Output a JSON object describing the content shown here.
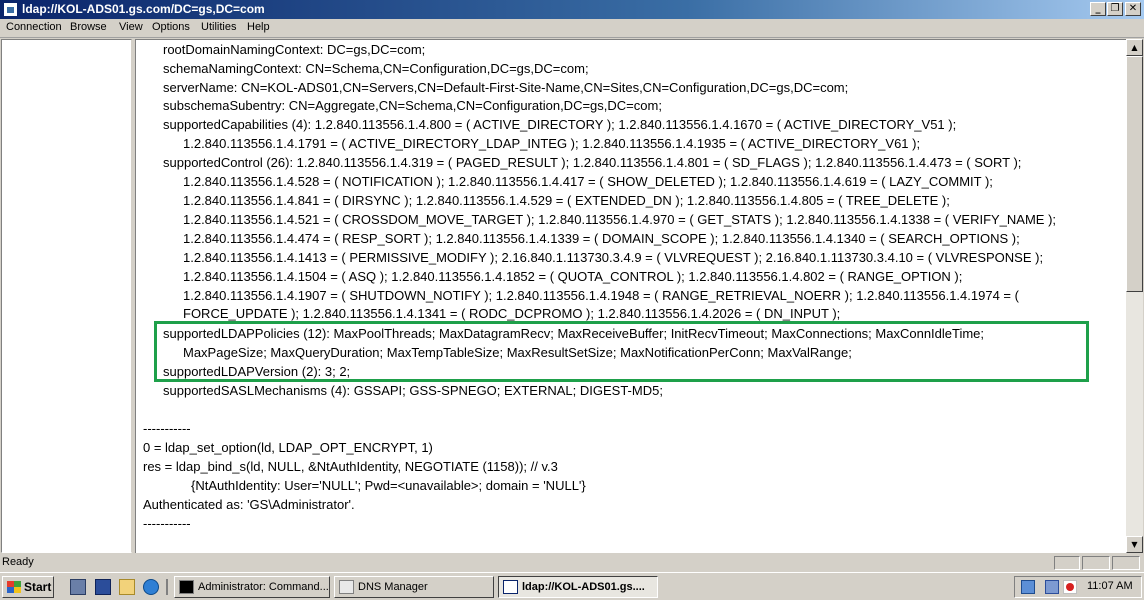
{
  "window": {
    "title": "ldap://KOL-ADS01.gs.com/DC=gs,DC=com",
    "min_glyph": "_",
    "max_glyph": "❐",
    "close_glyph": "✕"
  },
  "menu": [
    "Connection",
    "Browse",
    "View",
    "Options",
    "Utilities",
    "Help"
  ],
  "content_lines": [
    "rootDomainNamingContext: DC=gs,DC=com;",
    "schemaNamingContext: CN=Schema,CN=Configuration,DC=gs,DC=com;",
    "serverName: CN=KOL-ADS01,CN=Servers,CN=Default-First-Site-Name,CN=Sites,CN=Configuration,DC=gs,DC=com;",
    "subschemaSubentry: CN=Aggregate,CN=Schema,CN=Configuration,DC=gs,DC=com;",
    "supportedCapabilities (4): 1.2.840.113556.1.4.800 = ( ACTIVE_DIRECTORY ); 1.2.840.113556.1.4.1670 = ( ACTIVE_DIRECTORY_V51 );",
    "1.2.840.113556.1.4.1791 = ( ACTIVE_DIRECTORY_LDAP_INTEG ); 1.2.840.113556.1.4.1935 = ( ACTIVE_DIRECTORY_V61 );",
    "supportedControl (26): 1.2.840.113556.1.4.319 = ( PAGED_RESULT ); 1.2.840.113556.1.4.801 = ( SD_FLAGS ); 1.2.840.113556.1.4.473 = ( SORT );",
    "1.2.840.113556.1.4.528 = ( NOTIFICATION ); 1.2.840.113556.1.4.417 = ( SHOW_DELETED ); 1.2.840.113556.1.4.619 = ( LAZY_COMMIT );",
    "1.2.840.113556.1.4.841 = ( DIRSYNC ); 1.2.840.113556.1.4.529 = ( EXTENDED_DN ); 1.2.840.113556.1.4.805 = ( TREE_DELETE );",
    "1.2.840.113556.1.4.521 = ( CROSSDOM_MOVE_TARGET ); 1.2.840.113556.1.4.970 = ( GET_STATS ); 1.2.840.113556.1.4.1338 = ( VERIFY_NAME );",
    "1.2.840.113556.1.4.474 = ( RESP_SORT ); 1.2.840.113556.1.4.1339 = ( DOMAIN_SCOPE ); 1.2.840.113556.1.4.1340 = ( SEARCH_OPTIONS );",
    "1.2.840.113556.1.4.1413 = ( PERMISSIVE_MODIFY ); 2.16.840.1.113730.3.4.9 = ( VLVREQUEST ); 2.16.840.1.113730.3.4.10 = ( VLVRESPONSE );",
    "1.2.840.113556.1.4.1504 = ( ASQ ); 1.2.840.113556.1.4.1852 = ( QUOTA_CONTROL ); 1.2.840.113556.1.4.802 = ( RANGE_OPTION );",
    "1.2.840.113556.1.4.1907 = ( SHUTDOWN_NOTIFY ); 1.2.840.113556.1.4.1948 = ( RANGE_RETRIEVAL_NOERR ); 1.2.840.113556.1.4.1974 = (",
    "FORCE_UPDATE ); 1.2.840.113556.1.4.1341 = ( RODC_DCPROMO ); 1.2.840.113556.1.4.2026 = ( DN_INPUT );",
    "supportedLDAPPolicies (12): MaxPoolThreads; MaxDatagramRecv; MaxReceiveBuffer; InitRecvTimeout; MaxConnections; MaxConnIdleTime;",
    "MaxPageSize; MaxQueryDuration; MaxTempTableSize; MaxResultSetSize; MaxNotificationPerConn; MaxValRange;",
    "supportedLDAPVersion (2): 3; 2;",
    "supportedSASLMechanisms (4): GSSAPI; GSS-SPNEGO; EXTERNAL; DIGEST-MD5;",
    "-----------",
    "0 = ldap_set_option(ld, LDAP_OPT_ENCRYPT, 1)",
    "res = ldap_bind_s(ld, NULL, &NtAuthIdentity, NEGOTIATE (1158)); // v.3",
    "{NtAuthIdentity: User='NULL'; Pwd=<unavailable>; domain = 'NULL'}",
    "Authenticated as: 'GS\\Administrator'.",
    "-----------"
  ],
  "scrollbar": {
    "up_glyph": "▲",
    "down_glyph": "▼"
  },
  "status": {
    "text": "Ready"
  },
  "taskbar": {
    "start_label": "Start",
    "quick_launch": [
      "server-manager-icon",
      "powershell-icon",
      "explorer-icon",
      "ie-icon",
      "performance-icon"
    ],
    "tasks": [
      {
        "label": "Administrator: Command...",
        "icon": "cmd-icon",
        "active": false
      },
      {
        "label": "DNS Manager",
        "icon": "dns-icon",
        "active": false
      },
      {
        "label": "ldap://KOL-ADS01.gs....",
        "icon": "ldp-icon",
        "active": true
      }
    ],
    "clock": "11:07 AM"
  },
  "colors": {
    "highlight_box": "#1ea04a",
    "titlebar": "#0a246a"
  }
}
